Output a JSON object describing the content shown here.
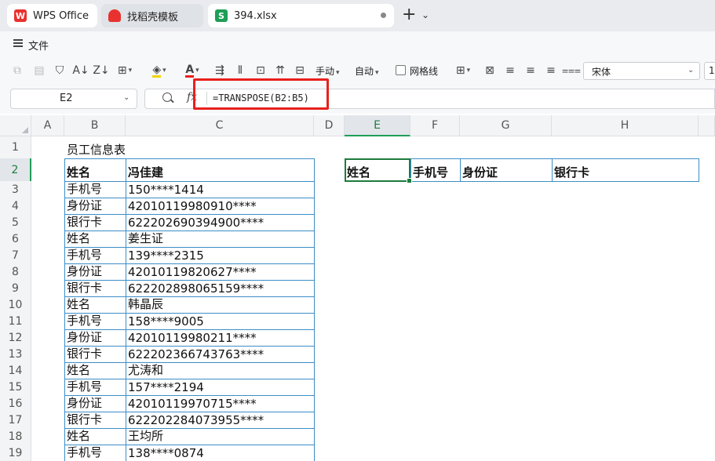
{
  "tabs": [
    {
      "label": "WPS Office",
      "icon": "wps-logo-icon"
    },
    {
      "label": "找稻壳模板",
      "icon": "docer-icon"
    },
    {
      "label": "394.xlsx",
      "icon": "spreadsheet-icon"
    }
  ],
  "tab_icon_letters": {
    "sheet": "S"
  },
  "menu": {
    "file_label": "文件"
  },
  "toolbar": {
    "wrap_label": "手动",
    "auto_label": "自动",
    "gridlines_label": "网格线",
    "font_name": "宋体",
    "font_size": "1"
  },
  "formula_bar": {
    "cell_ref": "E2",
    "formula": "=TRANSPOSE(B2:B5)"
  },
  "columns": [
    "A",
    "B",
    "C",
    "D",
    "E",
    "F",
    "G",
    "H"
  ],
  "rows": [
    "1",
    "2",
    "3",
    "4",
    "5",
    "6",
    "7",
    "8",
    "9",
    "10",
    "11",
    "12",
    "13",
    "14",
    "15",
    "16",
    "17",
    "18",
    "19"
  ],
  "sheet": {
    "title": "员工信息表",
    "records": [
      [
        "姓名",
        "冯佳建"
      ],
      [
        "手机号",
        "150****1414"
      ],
      [
        "身份证",
        "42010119980910****"
      ],
      [
        "银行卡",
        "622202690394900****"
      ],
      [
        "姓名",
        "姜生证"
      ],
      [
        "手机号",
        "139****2315"
      ],
      [
        "身份证",
        "42010119820627****"
      ],
      [
        "银行卡",
        "622202898065159****"
      ],
      [
        "姓名",
        "韩晶辰"
      ],
      [
        "手机号",
        "158****9005"
      ],
      [
        "身份证",
        "42010119980211****"
      ],
      [
        "银行卡",
        "622202366743763****"
      ],
      [
        "姓名",
        "尤涛和"
      ],
      [
        "手机号",
        "157****2194"
      ],
      [
        "身份证",
        "42010119970715****"
      ],
      [
        "银行卡",
        "622202284073955****"
      ],
      [
        "姓名",
        "王均所"
      ],
      [
        "手机号",
        "138****0874"
      ]
    ],
    "transposed_header": [
      "姓名",
      "手机号",
      "身份证",
      "银行卡"
    ]
  },
  "colors": {
    "accent_green": "#1e9e57",
    "table_border": "#3c8ec7",
    "highlight_red": "#e8201c"
  }
}
